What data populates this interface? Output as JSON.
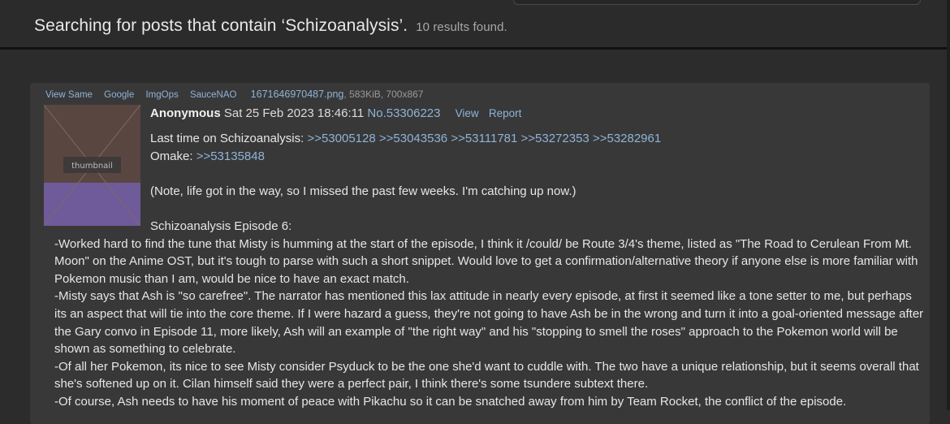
{
  "search": {
    "query_prefix": "Searching for posts that contain ‘Schizoanalysis’.",
    "results": "10 results found."
  },
  "post": {
    "file_links": [
      "View Same",
      "Google",
      "ImgOps",
      "SauceNAO"
    ],
    "file_name": "1671646970487.png",
    "file_meta": ", 583KiB, 700x867",
    "thumbnail_alt": "anime character thumbnail",
    "author": "Anonymous",
    "datetime": "Sat 25 Feb 2023 18:46:11",
    "post_number": "No.53306223",
    "actions": [
      "View",
      "Report"
    ],
    "last_time_label": "Last time on Schizoanalysis:",
    "last_time_links": [
      ">>53005128",
      ">>53043536",
      ">>53111781",
      ">>53272353",
      ">>53282961"
    ],
    "omake_label": "Omake:",
    "omake_link": ">>53135848",
    "note": "(Note, life got in the way, so I missed the past few weeks. I'm catching up now.)",
    "episode_title": "Schizoanalysis Episode 6:",
    "paragraphs": [
      "-Worked hard to find the tune that Misty is humming at the start of the episode, I think it /could/ be Route 3/4's theme, listed as \"The Road to Cerulean From Mt. Moon\" on the Anime OST, but it's tough to parse with such a short snippet. Would love to get a confirmation/alternative theory if anyone else is more familiar with Pokemon music than I am, would be nice to have an exact match.",
      "-Misty says that Ash is \"so carefree\". The narrator has mentioned this lax attitude in nearly every episode, at first it seemed like a tone setter to me, but perhaps its an aspect that will tie into the core theme. If I were hazard a guess, they're not going to have Ash be in the wrong and turn it into a goal-oriented message after the Gary convo in Episode 11, more likely, Ash will an example of \"the right way\" and his \"stopping to smell the roses\" approach to the Pokemon world will be shown as something to celebrate.",
      "-Of all her Pokemon, its nice to see Misty consider Psyduck to be the one she'd want to cuddle with. The two have a unique relationship, but it seems overall that she's softened up on it. Cilan himself said they were a perfect pair, I think there's some tsundere subtext there.",
      "-Of course, Ash needs to have his moment of peace with Pikachu so it can be snatched away from him by Team Rocket, the conflict of the episode."
    ]
  }
}
